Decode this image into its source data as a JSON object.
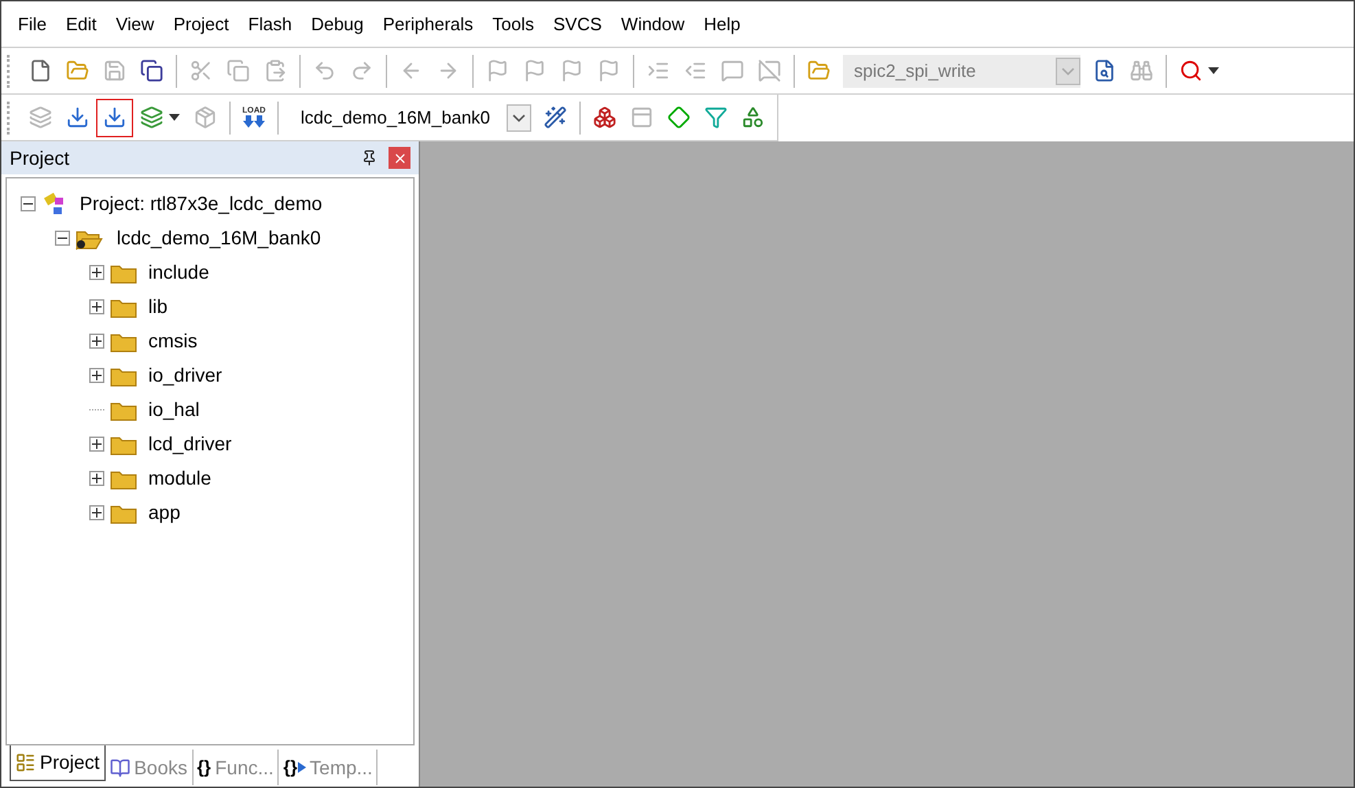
{
  "menu": [
    "File",
    "Edit",
    "View",
    "Project",
    "Flash",
    "Debug",
    "Peripherals",
    "Tools",
    "SVCS",
    "Window",
    "Help"
  ],
  "toolbar_1": [
    {
      "kind": "button",
      "disabled": false,
      "highlighted": false
    },
    {
      "kind": "button",
      "disabled": false,
      "highlighted": false
    },
    {
      "kind": "button",
      "disabled": true,
      "highlighted": false
    },
    {
      "kind": "button",
      "disabled": false,
      "highlighted": false
    },
    {
      "kind": "separator"
    },
    {
      "kind": "button",
      "disabled": true,
      "highlighted": false
    },
    {
      "kind": "button",
      "disabled": true,
      "highlighted": false
    },
    {
      "kind": "button",
      "disabled": true,
      "highlighted": false
    },
    {
      "kind": "separator"
    },
    {
      "kind": "button",
      "disabled": true,
      "highlighted": false
    },
    {
      "kind": "button",
      "disabled": true,
      "highlighted": false
    },
    {
      "kind": "separator"
    },
    {
      "kind": "button",
      "disabled": true,
      "highlighted": false
    },
    {
      "kind": "button",
      "disabled": true,
      "highlighted": false
    },
    {
      "kind": "separator"
    },
    {
      "kind": "button",
      "disabled": true,
      "highlighted": false
    },
    {
      "kind": "button",
      "disabled": true,
      "highlighted": false
    },
    {
      "kind": "button",
      "disabled": true,
      "highlighted": false
    },
    {
      "kind": "button",
      "disabled": true,
      "highlighted": false
    },
    {
      "kind": "separator"
    },
    {
      "kind": "button",
      "disabled": true,
      "highlighted": false
    },
    {
      "kind": "button",
      "disabled": true,
      "highlighted": false
    },
    {
      "kind": "button",
      "disabled": true,
      "highlighted": false
    },
    {
      "kind": "button",
      "disabled": true,
      "highlighted": false
    },
    {
      "kind": "separator"
    },
    {
      "kind": "button",
      "disabled": false,
      "highlighted": false
    },
    {
      "kind": "combo",
      "value": "spic2_spi_write",
      "disabled": true
    },
    {
      "kind": "button",
      "disabled": false,
      "highlighted": false
    },
    {
      "kind": "button",
      "disabled": true,
      "highlighted": false
    },
    {
      "kind": "separator"
    },
    {
      "kind": "dropdown",
      "disabled": false,
      "highlighted": false
    }
  ],
  "toolbar_2": [
    {
      "kind": "button",
      "disabled": true,
      "highlighted": false
    },
    {
      "kind": "button",
      "disabled": false,
      "highlighted": false
    },
    {
      "kind": "button",
      "disabled": false,
      "highlighted": true
    },
    {
      "kind": "dropdown",
      "disabled": false,
      "highlighted": false
    },
    {
      "kind": "button",
      "disabled": true,
      "highlighted": false
    },
    {
      "kind": "separator"
    },
    {
      "kind": "load",
      "label": "LOAD",
      "disabled": false,
      "highlighted": false
    },
    {
      "kind": "separator"
    },
    {
      "kind": "combo",
      "value": "lcdc_demo_16M_bank0",
      "disabled": false
    },
    {
      "kind": "button",
      "disabled": false,
      "highlighted": false
    },
    {
      "kind": "separator"
    },
    {
      "kind": "button",
      "disabled": false,
      "highlighted": false
    },
    {
      "kind": "button",
      "disabled": true,
      "highlighted": false
    },
    {
      "kind": "button",
      "disabled": false,
      "highlighted": false
    },
    {
      "kind": "button",
      "disabled": false,
      "highlighted": false
    },
    {
      "kind": "button",
      "disabled": false,
      "highlighted": false
    }
  ],
  "project_panel": {
    "title": "Project",
    "tree": [
      {
        "label": "Project: rtl87x3e_lcdc_demo",
        "kind": "project",
        "expander": true,
        "expanded": true,
        "children": [
          {
            "label": "lcdc_demo_16M_bank0",
            "kind": "target",
            "expander": true,
            "expanded": true,
            "children": [
              {
                "label": "include",
                "kind": "folder",
                "expander": true,
                "expanded": false
              },
              {
                "label": "lib",
                "kind": "folder",
                "expander": true,
                "expanded": false
              },
              {
                "label": "cmsis",
                "kind": "folder",
                "expander": true,
                "expanded": false
              },
              {
                "label": "io_driver",
                "kind": "folder",
                "expander": true,
                "expanded": false
              },
              {
                "label": "io_hal",
                "kind": "folder",
                "expander": false,
                "expanded": false
              },
              {
                "label": "lcd_driver",
                "kind": "folder",
                "expander": true,
                "expanded": false
              },
              {
                "label": "module",
                "kind": "folder",
                "expander": true,
                "expanded": false
              },
              {
                "label": "app",
                "kind": "folder",
                "expander": true,
                "expanded": false
              }
            ]
          }
        ]
      }
    ],
    "tabs": [
      {
        "label": "Project",
        "kind": "project",
        "selected": true
      },
      {
        "label": "Books",
        "kind": "books",
        "selected": false
      },
      {
        "label": "Func...",
        "glyph": "{}",
        "kind": "functions",
        "selected": false
      },
      {
        "label": "Temp...",
        "glyph": "{}",
        "kind": "templates",
        "selected": false
      }
    ]
  }
}
